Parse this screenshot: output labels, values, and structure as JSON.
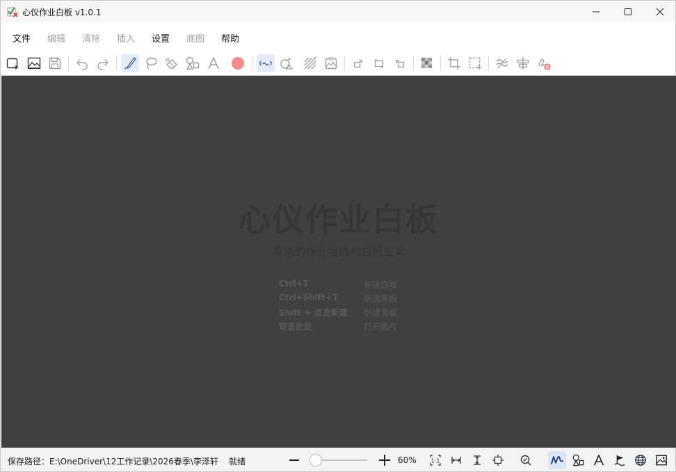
{
  "window": {
    "title": "心仪作业白板 v1.0.1",
    "icon": "app-logo-icon"
  },
  "menu": {
    "items": [
      {
        "label": "文件",
        "enabled": true
      },
      {
        "label": "编辑",
        "enabled": false
      },
      {
        "label": "清除",
        "enabled": false
      },
      {
        "label": "插入",
        "enabled": false
      },
      {
        "label": "设置",
        "enabled": true
      },
      {
        "label": "底图",
        "enabled": false
      },
      {
        "label": "帮助",
        "enabled": true
      }
    ]
  },
  "toolbar": {
    "tools": [
      "new-whiteboard-icon",
      "open-image-icon",
      "save-icon",
      "undo-icon",
      "redo-icon",
      "pen-icon",
      "lasso-icon",
      "eraser-icon",
      "shapes-icon",
      "text-icon",
      "color-swatch-icon",
      "smooth-stroke-icon",
      "shape-recognize-icon",
      "hatch-icon",
      "background-image-icon",
      "rotate-right-icon",
      "rotate-icon",
      "rotate-left-icon",
      "mosaic-icon",
      "crop-icon",
      "select-region-icon",
      "wave-icon",
      "split-icon",
      "signature-icon"
    ],
    "active_tools": [
      "pen-icon",
      "smooth-stroke-icon"
    ],
    "pen_color": "#f48a8a"
  },
  "canvas": {
    "background": "#404040",
    "brand": "心仪作业白板",
    "tagline": "简洁的作业批改和白板工具",
    "shortcuts": [
      {
        "key": "Ctrl+T",
        "action": "新建白板"
      },
      {
        "key": "Ctrl+Shift+T",
        "action": "新建黑板"
      },
      {
        "key": "Shift + 点击新建",
        "action": "创建黑板"
      },
      {
        "key": "双击此处",
        "action": "打开图片"
      }
    ]
  },
  "statusbar": {
    "save_path_label": "保存路径：",
    "save_path": "E:\\OneDriver\\12工作记录\\2026春季\\李泽轩",
    "status": "就绪",
    "zoom_percent": "60%",
    "zoom_level": 0.6,
    "fit_actual_label": "1:1",
    "mode_icons": [
      "handwriting-icon",
      "shapes-icon",
      "text-icon",
      "flag-icon",
      "globe-icon",
      "image-icon"
    ],
    "active_mode": "handwriting-icon"
  }
}
